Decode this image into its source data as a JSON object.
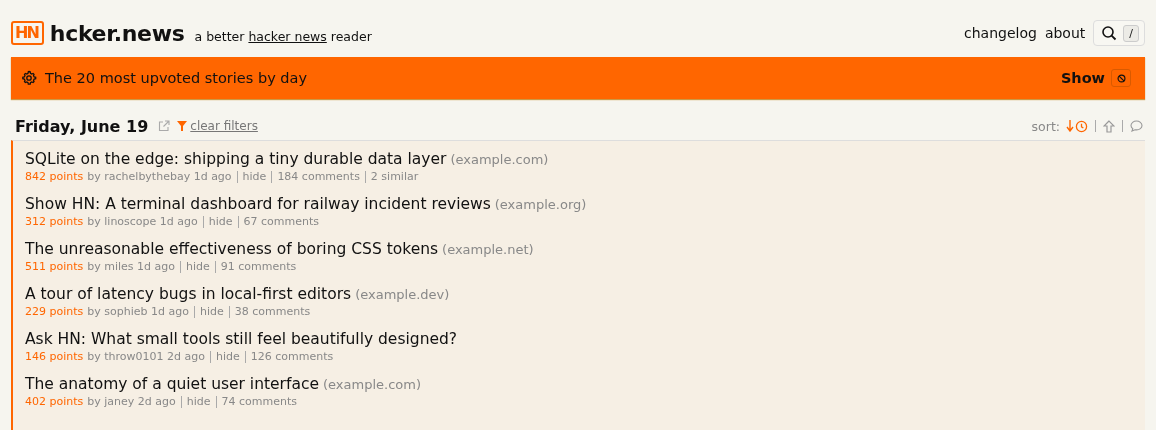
{
  "header": {
    "logo": "HN",
    "title": "hcker.news",
    "tagline": {
      "before": "a better ",
      "link": "hacker news",
      "after": " reader"
    },
    "nav": [
      "changelog",
      "about"
    ],
    "search_key": "/"
  },
  "banner": {
    "text": "The 20 most upvoted stories by day",
    "button": "Show"
  },
  "day": {
    "title": "Friday, June 19",
    "clear_filters": "clear filters",
    "sort_label": "sort:",
    "sort_options": [
      {
        "kind": "time",
        "selected": true
      },
      {
        "kind": "points",
        "selected": false
      },
      {
        "kind": "comments",
        "selected": false
      }
    ]
  },
  "stories": [
    {
      "title": "SQLite on the edge: shipping a tiny durable data layer",
      "domain": "(example.com)",
      "points": "842 points",
      "byline": "by rachelbythebay 1d ago",
      "links": [
        "hide",
        "184 comments",
        "2 similar"
      ]
    },
    {
      "title": "Show HN: A terminal dashboard for railway incident reviews",
      "domain": "(example.org)",
      "points": "312 points",
      "byline": "by linoscope 1d ago",
      "links": [
        "hide",
        "67 comments"
      ]
    },
    {
      "title": "The unreasonable effectiveness of boring CSS tokens",
      "domain": "(example.net)",
      "points": "511 points",
      "byline": "by miles 1d ago",
      "links": [
        "hide",
        "91 comments"
      ]
    },
    {
      "title": "A tour of latency bugs in local-first editors",
      "domain": "(example.dev)",
      "points": "229 points",
      "byline": "by sophieb 1d ago",
      "links": [
        "hide",
        "38 comments"
      ]
    },
    {
      "title": "Ask HN: What small tools still feel beautifully designed?",
      "points": "146 points",
      "byline": "by throw0101 2d ago",
      "links": [
        "hide",
        "126 comments"
      ]
    },
    {
      "title": "The anatomy of a quiet user interface",
      "domain": "(example.com)",
      "points": "402 points",
      "byline": "by janey 2d ago",
      "links": [
        "hide",
        "74 comments"
      ]
    }
  ]
}
